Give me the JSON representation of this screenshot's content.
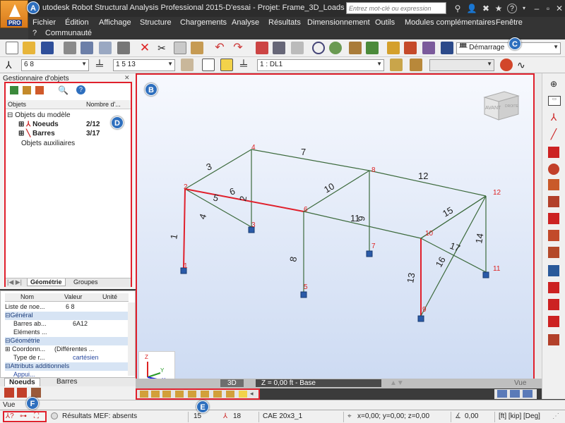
{
  "window": {
    "title": "utodesk Robot Structural Analysis Professional 2015-D'essai - Projet: Frame_3D_Loads - Résultats M...",
    "logo_label": "PRO",
    "search_placeholder": "Entrez mot-clé ou expression"
  },
  "menu": {
    "row1": [
      "Fichier",
      "Édition",
      "Affichage",
      "Structure",
      "Chargements",
      "Analyse",
      "Résultats",
      "Dimensionnement",
      "Outils",
      "Modules complémentaires",
      "Fenêtre"
    ],
    "row2": [
      "?",
      "Communauté"
    ]
  },
  "toolbar": {
    "layout_combo": "Démarrage",
    "nodes_combo": "6 8",
    "bars_combo": "1 5 13",
    "case_combo": "1 : DL1"
  },
  "object_manager": {
    "title": "Gestionnaire d'objets",
    "col_objects": "Objets",
    "col_count": "Nombre d'...",
    "root": "Objets du modèle",
    "nodes_label": "Noeuds",
    "nodes_count": "2/12",
    "bars_label": "Barres",
    "bars_count": "3/17",
    "aux": "Objets auxiliaires",
    "tab_geometry": "Géométrie",
    "tab_groups": "Groupes"
  },
  "properties": {
    "col_name": "Nom",
    "col_value": "Valeur",
    "col_unit": "Unité",
    "list_label": "Liste de noe...",
    "list_value": "6 8",
    "sec_general": "Général",
    "bars_ab_label": "Barres ab...",
    "bars_ab_value": "6A12",
    "elements_label": "Eléments ...",
    "sec_geometry": "Géométrie",
    "coord_label": "Coordonn...",
    "coord_value": "(Différentes ...",
    "type_label": "Type de r...",
    "type_value": "cartésien",
    "sec_attr": "Attributs additionnels",
    "appui_label": "Appui...",
    "tab_nodes": "Noeuds",
    "tab_bars": "Barres"
  },
  "viewport": {
    "view_cube_front": "AVANT",
    "view_cube_right": "DROITE",
    "tab_3d": "3D",
    "z_level": "Z = 0,00 ft - Base",
    "tab_vue": "Vue",
    "axis_x": "X",
    "axis_y": "Y",
    "axis_z": "Z",
    "node_labels": [
      "1",
      "2",
      "3",
      "4",
      "5",
      "6",
      "7",
      "8",
      "9",
      "10",
      "11",
      "12"
    ],
    "bar_labels": [
      "1",
      "2",
      "3",
      "4",
      "5",
      "6",
      "7",
      "8",
      "9",
      "10",
      "11",
      "12",
      "13",
      "14",
      "15",
      "16",
      "17"
    ]
  },
  "status": {
    "vue_label": "Vue",
    "mef": "Résultats MEF: absents",
    "n1": "15",
    "n2": "18",
    "section": "CAE 20x3_1",
    "coords": "x=0,00; y=0,00; z=0,00",
    "angle": "0,00",
    "units": "[ft] [kip] [Deg]"
  },
  "badges": [
    "A",
    "B",
    "C",
    "D",
    "E",
    "F"
  ],
  "colors": {
    "highlight_red": "#e0202c",
    "bar_green": "#3c6a3c",
    "bar_selected": "#e0202c",
    "badge_blue": "#2e6fbe"
  }
}
